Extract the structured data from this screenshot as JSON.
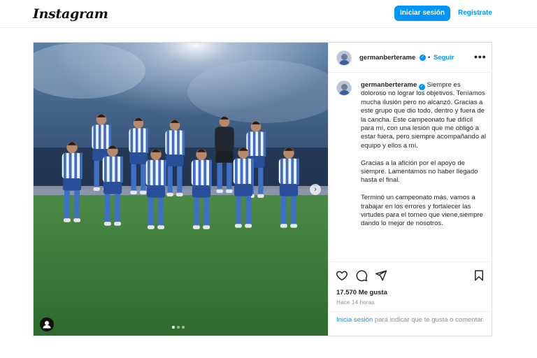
{
  "topbar": {
    "logo": "Instagram",
    "login_button": "Iniciar sesión",
    "register_link": "Regístrate"
  },
  "post": {
    "author": "germanberterame",
    "follow_label": "Seguir",
    "separator": "•",
    "more_label": "•••",
    "caption_paragraphs": [
      "Siempre es doloroso no lograr los objetivos. Teníamos mucha ilusión pero no alcanzó. Gracias a este grupo que dio todo, dentro y fuera de la cancha. Este campeonato fue difícil para mí, con una lesión que me obligó a estar fuera, pero siempre acompañando al equipo y ellos a mí.",
      "Gracias a la afición por el apoyo de siempre. Lamentamos no haber llegado hasta el final.",
      "Terminó un campeonato más, vamos a trabajar en los errores y fortalecer las virtudes para el torneo que viene,siempre dando lo mejor de nosotros."
    ],
    "likes": "17.570 Me gusta",
    "time_ago": "Hace 14 horas",
    "login_prompt_link": "Inicia sesión",
    "login_prompt_text": " para indicar que te gusta o comentar.",
    "carousel_total": 3,
    "carousel_active": 1,
    "next_label": "›"
  },
  "icons": {
    "like": "heart-icon",
    "comment": "comment-icon",
    "share": "paper-plane-icon",
    "save": "bookmark-icon",
    "verified": "verified-badge-icon",
    "tagged_user": "user-tag-icon",
    "next": "chevron-right-icon"
  },
  "colors": {
    "accent": "#0095f6",
    "text": "#262626",
    "muted": "#8e8e8e",
    "kit_blue": "#3f6fc4",
    "kit_white": "#f1f3f8",
    "pitch": "#3f7a3a"
  }
}
